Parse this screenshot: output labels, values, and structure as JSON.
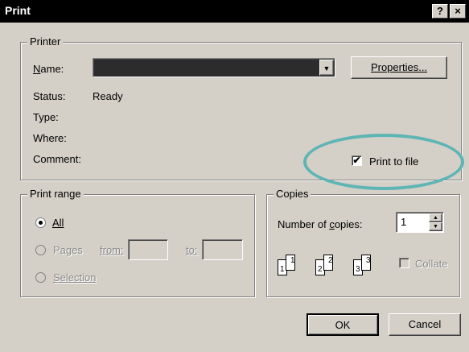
{
  "window": {
    "title": "Print",
    "help_btn": "?",
    "close_btn": "×"
  },
  "printer": {
    "group_label": "Printer",
    "name_label": "Name:",
    "name_value": "",
    "properties_button": "Properties...",
    "status_label": "Status:",
    "status_value": "Ready",
    "type_label": "Type:",
    "where_label": "Where:",
    "comment_label": "Comment:",
    "print_to_file_label": "Print to file",
    "print_to_file_checked": "✔"
  },
  "print_range": {
    "group_label": "Print range",
    "all_label": "All",
    "pages_label": "Pages",
    "from_label": "from:",
    "to_label": "to:",
    "selection_label": "Selection"
  },
  "copies": {
    "group_label": "Copies",
    "number_label": "Number of copies:",
    "number_value": "1",
    "collate_label": "Collate",
    "collate_icons": [
      "1",
      "1",
      "2",
      "2",
      "3",
      "3"
    ]
  },
  "buttons": {
    "ok": "OK",
    "cancel": "Cancel"
  },
  "colors": {
    "highlight_ring": "#5fb5b4"
  }
}
